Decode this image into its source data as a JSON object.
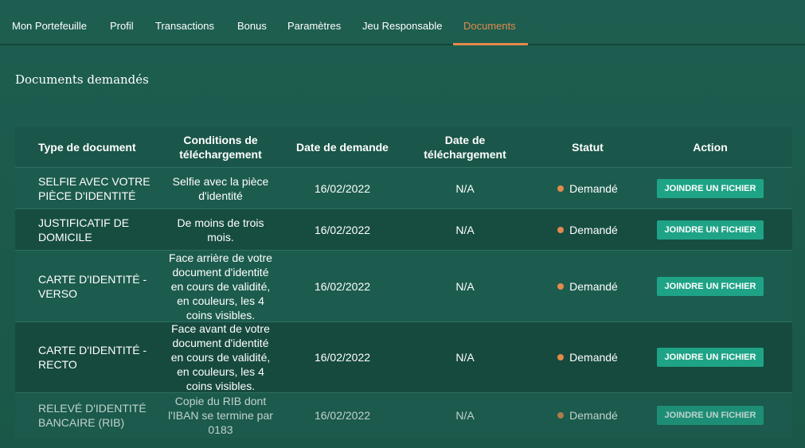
{
  "tabs": [
    {
      "label": "Mon Portefeuille",
      "active": false
    },
    {
      "label": "Profil",
      "active": false
    },
    {
      "label": "Transactions",
      "active": false
    },
    {
      "label": "Bonus",
      "active": false
    },
    {
      "label": "Paramètres",
      "active": false
    },
    {
      "label": "Jeu Responsable",
      "active": false
    },
    {
      "label": "Documents",
      "active": true
    }
  ],
  "section_title": "Documents demandés",
  "table": {
    "headers": {
      "type": "Type de document",
      "conditions": "Conditions de téléchargement",
      "request_date": "Date de demande",
      "upload_date": "Date de téléchargement",
      "status": "Statut",
      "action": "Action"
    },
    "rows": [
      {
        "type": "SELFIE AVEC VOTRE PIÈCE D'IDENTITÉ",
        "conditions": "Selfie avec la pièce d'identité",
        "request_date": "16/02/2022",
        "upload_date": "N/A",
        "status": "Demandé",
        "action": "JOINDRE UN FICHIER"
      },
      {
        "type": "JUSTIFICATIF DE DOMICILE",
        "conditions": "De moins de trois mois.",
        "request_date": "16/02/2022",
        "upload_date": "N/A",
        "status": "Demandé",
        "action": "JOINDRE UN FICHIER"
      },
      {
        "type": "CARTE D'IDENTITÉ - VERSO",
        "conditions": "Face arrière de votre document d'identité en cours de validité, en couleurs, les 4 coins visibles.",
        "request_date": "16/02/2022",
        "upload_date": "N/A",
        "status": "Demandé",
        "action": "JOINDRE UN FICHIER"
      },
      {
        "type": "CARTE D'IDENTITÉ - RECTO",
        "conditions": "Face avant de votre document d'identité en cours de validité, en couleurs, les 4 coins visibles.",
        "request_date": "16/02/2022",
        "upload_date": "N/A",
        "status": "Demandé",
        "action": "JOINDRE UN FICHIER"
      },
      {
        "type": "RELEVÉ D'IDENTITÉ BANCAIRE (RIB)",
        "conditions": "Copie du RIB dont l'IBAN se termine par 0183",
        "request_date": "16/02/2022",
        "upload_date": "N/A",
        "status": "Demandé",
        "action": "JOINDRE UN FICHIER"
      }
    ]
  },
  "colors": {
    "background": "#1c5a4c",
    "accent_orange": "#e38a4a",
    "button_green": "#1fa386",
    "status_dot": "#e38a4a"
  },
  "icons": {
    "status": "status-dot-icon"
  }
}
